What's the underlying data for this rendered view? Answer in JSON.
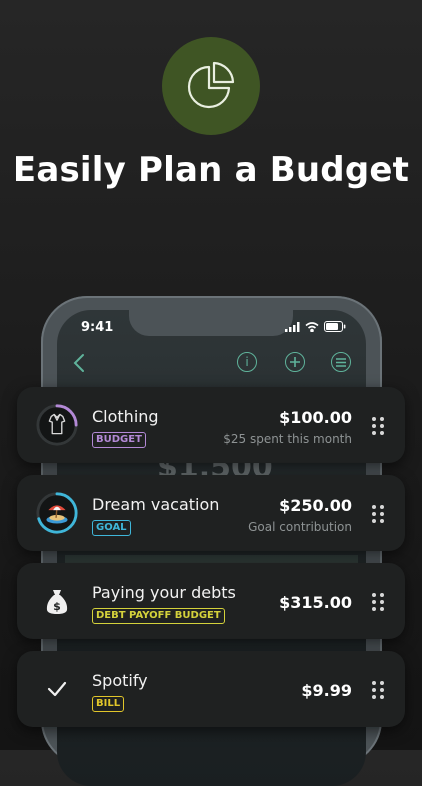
{
  "headline": "Easily Plan a Budget",
  "accent_color": "#5fb39b",
  "hero_icon": "pie-chart-icon",
  "phone": {
    "time": "9:41",
    "background_amount": "$1,500"
  },
  "cards": [
    {
      "title": "Clothing",
      "badge": "BUDGET",
      "badge_color": "#b389d6",
      "amount": "$100.00",
      "subtitle": "$25 spent this month",
      "icon": "shirt-icon",
      "progress": 0.25
    },
    {
      "title": "Dream vacation",
      "badge": "GOAL",
      "badge_color": "#3fb6d9",
      "amount": "$250.00",
      "subtitle": "Goal contribution",
      "icon": "island-icon",
      "progress": 0.7
    },
    {
      "title": "Paying your debts",
      "badge": "DEBT PAYOFF BUDGET",
      "badge_color": "#d4d23b",
      "amount": "$315.00",
      "subtitle": "",
      "icon": "money-bag-icon"
    },
    {
      "title": "Spotify",
      "badge": "BILL",
      "badge_color": "#e1c62a",
      "amount": "$9.99",
      "subtitle": "",
      "icon": "checkmark-icon"
    }
  ]
}
